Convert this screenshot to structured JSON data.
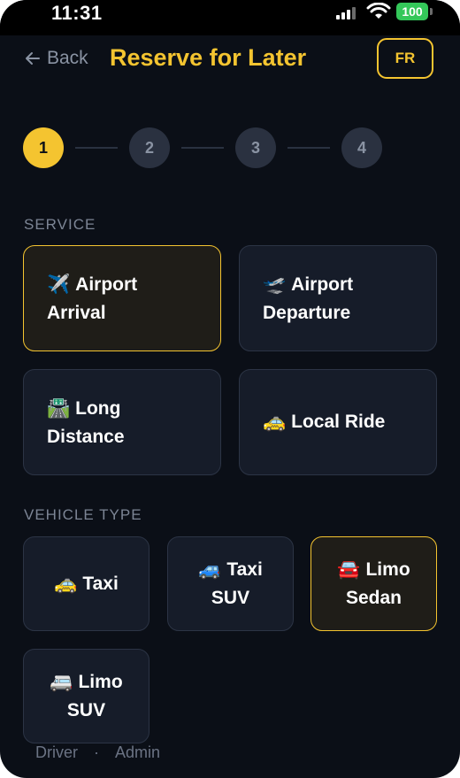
{
  "status_bar": {
    "time": "11:31",
    "battery": "100",
    "battery_color": "#34c759"
  },
  "header": {
    "back_label": "Back",
    "back_icon": "arrow-left-icon",
    "title": "Reserve for Later",
    "language_button": "FR",
    "accent_color": "#f4c430"
  },
  "stepper": {
    "steps": [
      "1",
      "2",
      "3",
      "4"
    ],
    "active_step": 1
  },
  "service": {
    "label": "SERVICE",
    "options": [
      {
        "emoji": "✈️",
        "line1": "Airport",
        "line2": "Arrival",
        "selected": true
      },
      {
        "emoji": "🛫",
        "line1": "Airport",
        "line2": "Departure",
        "selected": false
      },
      {
        "emoji": "🛣️",
        "line1": "Long",
        "line2": "Distance",
        "selected": false
      },
      {
        "emoji": "🚕",
        "line1": "Local Ride",
        "line2": "",
        "selected": false
      }
    ]
  },
  "vehicle": {
    "label": "VEHICLE TYPE",
    "options": [
      {
        "emoji": "🚕",
        "line1": "Taxi",
        "line2": "",
        "selected": false
      },
      {
        "emoji": "🚙",
        "line1": "Taxi",
        "line2": "SUV",
        "selected": false
      },
      {
        "emoji": "🚘",
        "line1": "Limo",
        "line2": "Sedan",
        "selected": true
      },
      {
        "emoji": "🚐",
        "line1": "Limo",
        "line2": "SUV",
        "selected": false
      }
    ]
  },
  "footer": {
    "links": [
      "Driver",
      "Admin"
    ],
    "separator": "·"
  }
}
